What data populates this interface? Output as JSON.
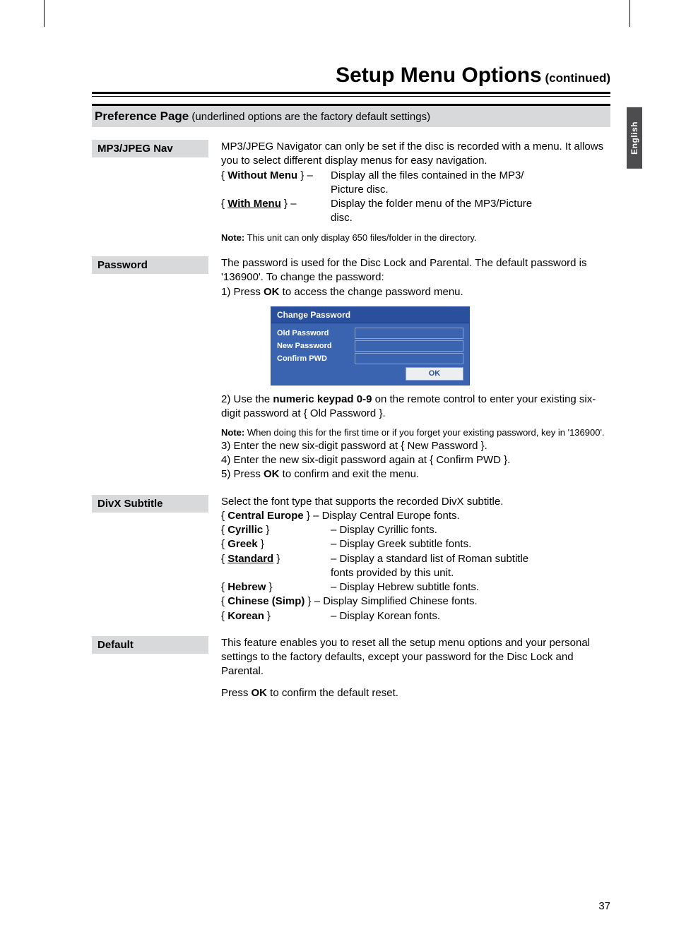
{
  "side_tab": "English",
  "title": "Setup Menu Options",
  "title_cont": " (continued)",
  "pref_header_bold": "Preference Page",
  "pref_header_rest": " (underlined options are the factory default settings)",
  "mp3": {
    "label": "MP3/JPEG Nav",
    "intro": "MP3/JPEG Navigator can only be set if the disc is recorded with a menu. It allows you to select different display menus for easy navigation.",
    "opt1_key": "Without Menu",
    "opt1_desc_a": "Display all the files contained in the MP3/",
    "opt1_desc_b": "Picture disc.",
    "opt2_key": "With Menu",
    "opt2_desc_a": "Display the folder menu of the MP3/Picture",
    "opt2_desc_b": "disc.",
    "note_bold": "Note:",
    "note_rest": "  This unit can only display 650 files/folder in the directory."
  },
  "password": {
    "label": "Password",
    "intro": "The password is used for the Disc Lock and Parental. The default password is '136900'. To change the password:",
    "step1_a": "1)  Press ",
    "step1_ok": "OK",
    "step1_b": " to access the change password menu.",
    "box_title": "Change Password",
    "box_old": "Old Password",
    "box_new": "New Password",
    "box_confirm": "Confirm PWD",
    "box_ok": "OK",
    "step2_a": "2)  Use the ",
    "step2_kp": "numeric keypad 0-9",
    "step2_b": " on the remote control to enter your existing six-digit password at { Old Password }.",
    "note_bold": "Note:",
    "note_rest": "  When doing this for the first time or if you forget your existing password, key in '136900'.",
    "step3": "3)  Enter the new six-digit password at { New Password }.",
    "step4": "4)  Enter the new six-digit password again at { Confirm PWD }.",
    "step5_a": "5)  Press ",
    "step5_ok": "OK",
    "step5_b": " to confirm and exit the menu."
  },
  "divx": {
    "label": "DivX Subtitle",
    "intro": "Select the font type that supports the recorded DivX subtitle.",
    "ce_key": "Central Europe",
    "ce_desc": "– Display Central Europe fonts.",
    "cy_key": "Cyrillic",
    "cy_desc": "– Display Cyrillic fonts.",
    "gr_key": "Greek",
    "gr_desc": "– Display Greek subtitle fonts.",
    "st_key": "Standard",
    "st_desc_a": "– Display a standard list of Roman subtitle",
    "st_desc_b": "fonts provided by this unit.",
    "he_key": "Hebrew",
    "he_desc": "– Display Hebrew subtitle fonts.",
    "ch_key": "Chinese (Simp)",
    "ch_desc": "– Display Simplified Chinese fonts.",
    "ko_key": "Korean",
    "ko_desc": "– Display Korean fonts."
  },
  "defaultSec": {
    "label": "Default",
    "p1": "This feature enables you to reset all the setup menu options and your personal settings to the factory defaults, except your password for the Disc Lock and Parental.",
    "p2_a": "Press ",
    "p2_ok": "OK",
    "p2_b": " to confirm the default reset."
  },
  "page_num": "37"
}
